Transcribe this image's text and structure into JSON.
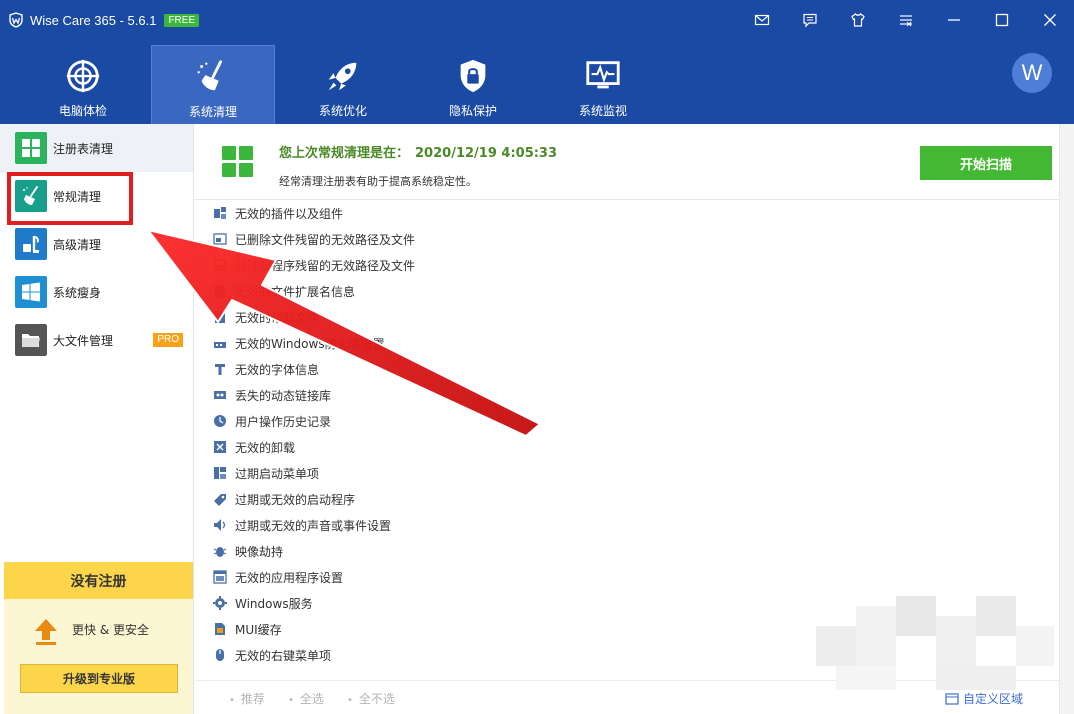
{
  "window": {
    "title": "Wise Care 365 - 5.6.1",
    "badge": "FREE"
  },
  "window_controls": [
    {
      "name": "mail-icon"
    },
    {
      "name": "feedback-icon"
    },
    {
      "name": "skin-icon"
    },
    {
      "name": "menu-icon"
    },
    {
      "name": "minimize-icon"
    },
    {
      "name": "maximize-icon"
    },
    {
      "name": "close-icon"
    }
  ],
  "nav": {
    "tabs": [
      {
        "label": "电脑体检",
        "icon": "checkup-icon"
      },
      {
        "label": "系统清理",
        "icon": "broom-icon",
        "active": true
      },
      {
        "label": "系统优化",
        "icon": "rocket-icon"
      },
      {
        "label": "隐私保护",
        "icon": "lock-shield-icon"
      },
      {
        "label": "系统监视",
        "icon": "monitor-pulse-icon"
      }
    ],
    "avatar": "W"
  },
  "sidebar": {
    "items": [
      {
        "label": "注册表清理",
        "icon": "registry-grid-icon",
        "color": "#2db35e",
        "active": true
      },
      {
        "label": "常规清理",
        "icon": "broom-icon",
        "color": "#1a9e8c"
      },
      {
        "label": "高级清理",
        "icon": "vacuum-icon",
        "color": "#1f7bc9"
      },
      {
        "label": "系统瘦身",
        "icon": "windows-icon",
        "color": "#1e8fd0"
      },
      {
        "label": "大文件管理",
        "icon": "folder-icon",
        "color": "#555555",
        "badge": "PRO"
      }
    ],
    "promo": {
      "title": "没有注册",
      "subtitle": "更快 & 更安全",
      "button": "升级到专业版"
    }
  },
  "summary": {
    "label": "您上次常规清理是在：",
    "value": "2020/12/19 4:05:33",
    "description": "经常清理注册表有助于提高系统稳定性。",
    "scan_button": "开始扫描"
  },
  "items": [
    {
      "label": "无效的插件以及组件",
      "icon": "plugin-icon"
    },
    {
      "label": "已删除文件残留的无效路径及文件",
      "icon": "file-path-icon"
    },
    {
      "label": "已注册程序残留的无效路径及文件",
      "icon": "program-icon"
    },
    {
      "label": "无效的文件扩展名信息",
      "icon": "file-ext-icon"
    },
    {
      "label": "无效的帮助文件",
      "icon": "help-file-icon"
    },
    {
      "label": "无效的Windows防火墙设置",
      "icon": "firewall-icon"
    },
    {
      "label": "无效的字体信息",
      "icon": "font-icon"
    },
    {
      "label": "丢失的动态链接库",
      "icon": "dll-icon"
    },
    {
      "label": "用户操作历史记录",
      "icon": "history-icon"
    },
    {
      "label": "无效的卸载",
      "icon": "uninstall-icon"
    },
    {
      "label": "过期启动菜单项",
      "icon": "start-menu-icon"
    },
    {
      "label": "过期或无效的启动程序",
      "icon": "startup-icon"
    },
    {
      "label": "过期或无效的声音或事件设置",
      "icon": "sound-icon"
    },
    {
      "label": "映像劫持",
      "icon": "bug-icon"
    },
    {
      "label": "无效的应用程序设置",
      "icon": "app-settings-icon"
    },
    {
      "label": "Windows服务",
      "icon": "gear-icon"
    },
    {
      "label": "MUI缓存",
      "icon": "mui-cache-icon"
    },
    {
      "label": "无效的右键菜单项",
      "icon": "mouse-icon"
    }
  ],
  "footer": {
    "recommend": "推荐",
    "select_all": "全选",
    "select_none": "全不选",
    "custom_area": "自定义区域"
  },
  "colors": {
    "brand_blue": "#1a4aa3",
    "active_tab": "#3a68c0",
    "green": "#43b833",
    "highlight_red": "#e21d1d"
  }
}
